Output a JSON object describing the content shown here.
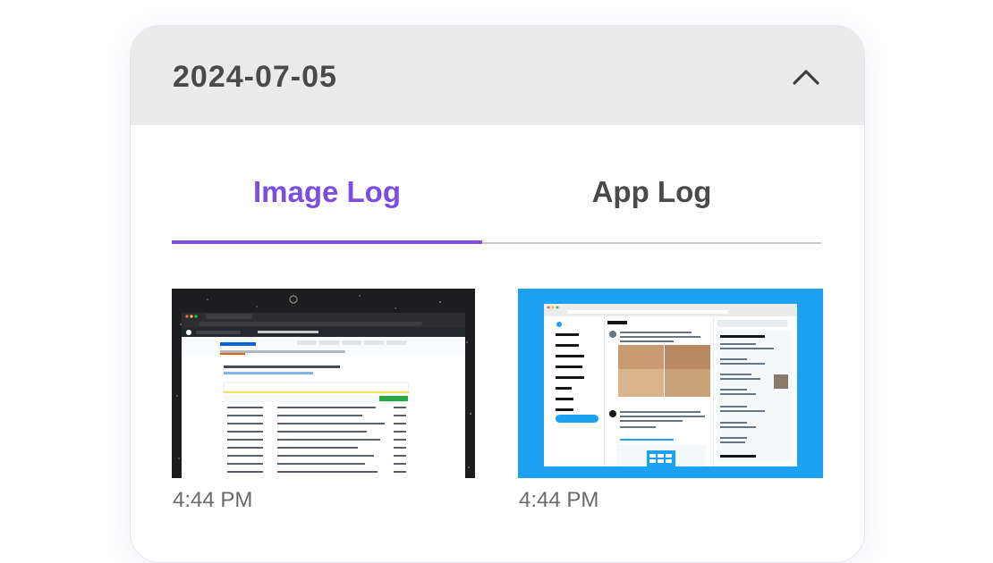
{
  "header": {
    "date": "2024-07-05",
    "collapse_icon": "chevron-up-icon"
  },
  "tabs": [
    {
      "label": "Image Log",
      "active": true
    },
    {
      "label": "App Log",
      "active": false
    }
  ],
  "entries": [
    {
      "time": "4:44 PM",
      "thumbnail": "github-repository-screenshot"
    },
    {
      "time": "4:44 PM",
      "thumbnail": "twitter-home-screenshot"
    }
  ],
  "colors": {
    "accent": "#7c4ddf",
    "header_bg": "#ebebeb",
    "twitter_blue": "#1da1f2"
  }
}
